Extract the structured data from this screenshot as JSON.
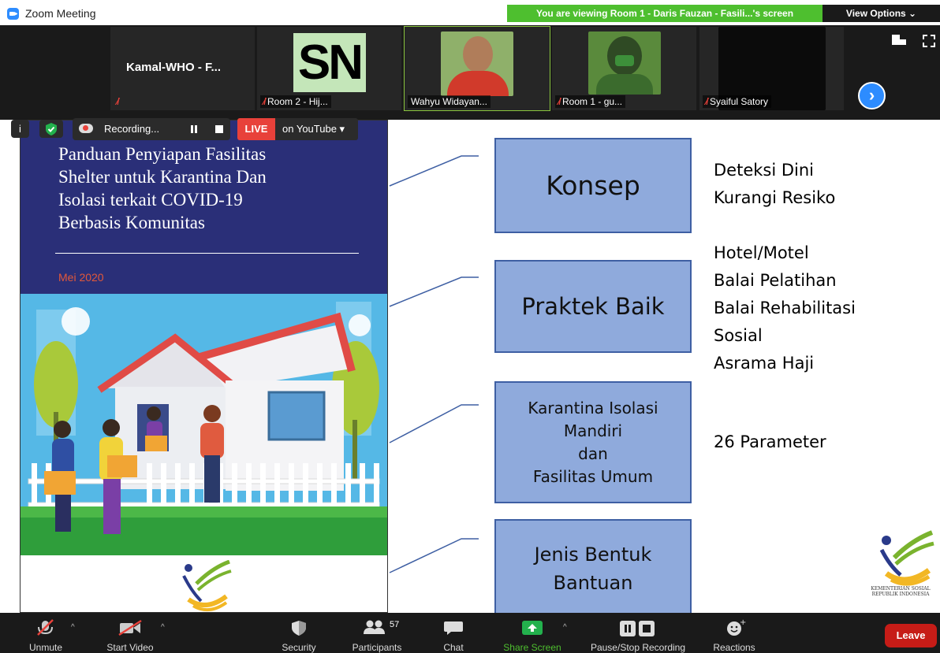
{
  "window": {
    "title": "Zoom Meeting"
  },
  "header": {
    "viewing_banner": "You are viewing Room 1 - Daris Fauzan - Fasili...'s screen",
    "view_options": "View Options ⌄"
  },
  "participants": [
    {
      "name": "",
      "big_name": "Kamal-WHO  -  F...",
      "muted": true
    },
    {
      "name": "Room 2 - Hij...",
      "initials": "SN",
      "muted": true
    },
    {
      "name": "Wahyu Widayan...",
      "muted": false,
      "active": true
    },
    {
      "name": "Room 1 - gu...",
      "muted": true
    },
    {
      "name": "Syaiful Satory",
      "muted": true
    }
  ],
  "recording": {
    "status": "Recording...",
    "live": "LIVE",
    "platform": "on YouTube ▾"
  },
  "slide": {
    "book_title": "Panduan Penyiapan Fasilitas\nShelter untuk Karantina Dan\nIsolasi terkait COVID-19\nBerbasis Komunitas",
    "book_date": "Mei 2020",
    "boxes": {
      "konsep": "Konsep",
      "praktek": "Praktek Baik",
      "karantina": [
        "Karantina Isolasi",
        "Mandiri",
        "dan",
        "Fasilitas Umum"
      ],
      "jenis": [
        "Jenis Bentuk",
        "Bantuan"
      ]
    },
    "notes": {
      "konsep": [
        "Deteksi Dini",
        "Kurangi Resiko"
      ],
      "praktek": [
        "Hotel/Motel",
        "Balai Pelatihan",
        "Balai Rehabilitasi",
        "Sosial",
        "Asrama Haji"
      ],
      "karantina": "26 Parameter"
    },
    "logo_label": [
      "KEMENTERIAN SOSIAL",
      "REPUBLIK INDONESIA"
    ]
  },
  "toolbar": {
    "unmute": "Unmute",
    "start_video": "Start Video",
    "security": "Security",
    "participants": "Participants",
    "participants_count": "57",
    "chat": "Chat",
    "share_screen": "Share Screen",
    "pause_recording": "Pause/Stop Recording",
    "reactions": "Reactions",
    "leave": "Leave"
  },
  "colors": {
    "share_green": "#4ebf2f",
    "zoom_blue": "#2d8cff",
    "leave_red": "#c61c17",
    "slide_box": "#8faadc",
    "book_navy": "#2a2f78"
  }
}
